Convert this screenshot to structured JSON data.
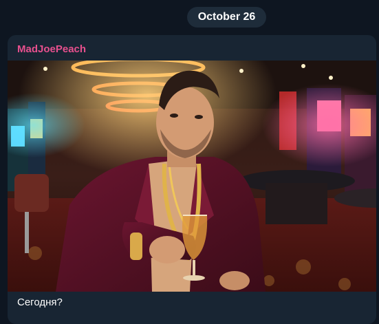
{
  "chat": {
    "date_label": "October 26"
  },
  "message": {
    "sender_name": "MadJoePeach",
    "caption": "Сегодня?",
    "photo_icon": "casino-portrait-photo"
  },
  "colors": {
    "background": "#0e1621",
    "bubble": "#182533",
    "date_pill": "#1e2c3a",
    "sender_name": "#e8508e",
    "text": "#ffffff"
  }
}
